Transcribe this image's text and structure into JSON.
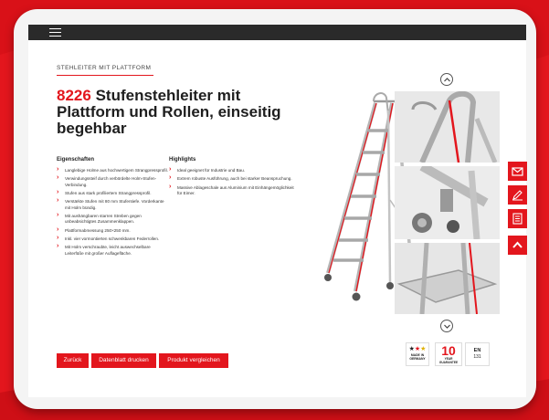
{
  "breadcrumb": "Stehleiter mit Plattform",
  "product": {
    "number": "8226",
    "title": "Stufenstehleiter mit Plattform und Rollen, einseitig begehbar"
  },
  "features": {
    "heading": "Eigenschaften",
    "items": [
      "Langlebige Holme aus hochwertigem Strangpressprofil.",
      "Verwindungssteif durch verbördelte Holm-Stufen-Verbindung.",
      "Stufen aus stark profiliertem Strangpressprofil.",
      "Verstärkte Stufen mit 80 mm Stufentiefe. Vorderkante mit Holm bündig.",
      "Mit aushängbaren starren Streben gegen unbeabsichtigtes Zusammenklappen.",
      "Plattformabmessung 250×250 mm.",
      "Inkl. vier vormontierten schwenkbaren Federrollen.",
      "Mit Holm verschraubte, leicht auswechselbare Leiterfüße mit großer Auflagefläche."
    ]
  },
  "highlights": {
    "heading": "Highlights",
    "items": [
      "Ideal geeignet für Industrie und Bau.",
      "Extrem robuste Ausführung, auch bei starker Beanspruchung.",
      "Massive Ablageschale aus Aluminium mit Einhängemöglichkeit für Eimer."
    ]
  },
  "buttons": {
    "back": "Zurück",
    "datasheet": "Datenblatt drucken",
    "compare": "Produkt vergleichen"
  },
  "badges": {
    "made_in": "MADE IN GERMANY",
    "warranty_number": "10",
    "warranty_text": "YEAR GUARANTEE",
    "norm_line1": "EN",
    "norm_line2": "131"
  },
  "icons": {
    "menu": "hamburger-icon",
    "up": "chevron-up-icon",
    "down": "chevron-down-icon",
    "side": [
      "mail-icon",
      "pen-icon",
      "document-icon",
      "arrow-up-icon"
    ]
  },
  "colors": {
    "brand_red": "#e3161d",
    "topbar": "#2a2a2a"
  }
}
